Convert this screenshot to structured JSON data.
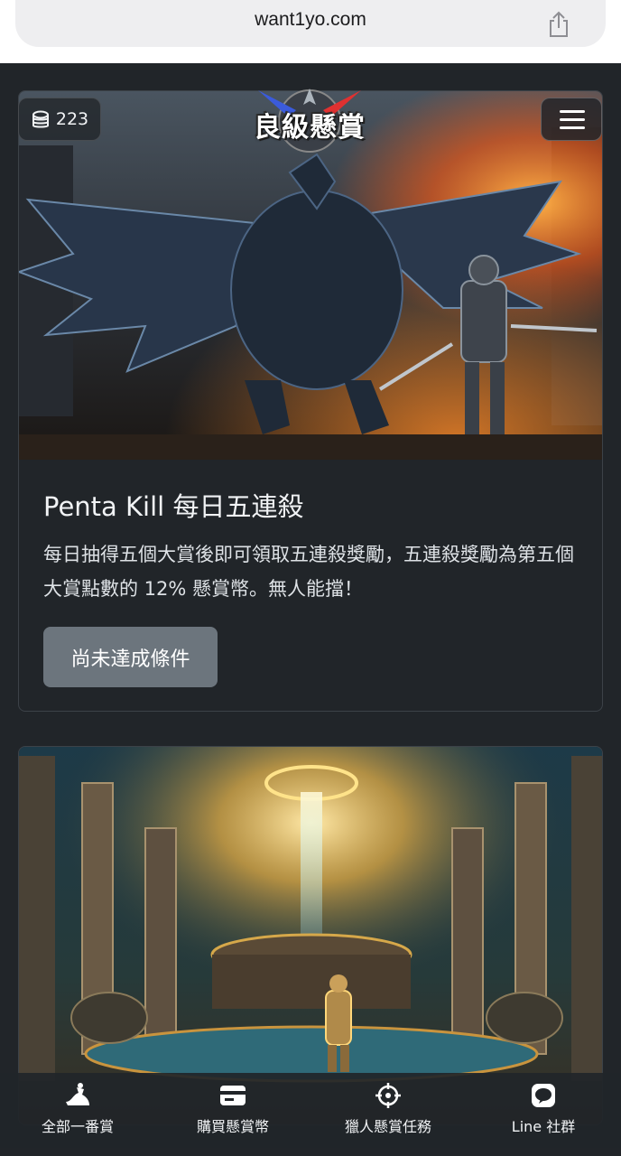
{
  "browser": {
    "url": "want1yo.com"
  },
  "header": {
    "coins": "223",
    "logo_text": "良級懸賞"
  },
  "cards": [
    {
      "title": "Penta Kill 每日五連殺",
      "description": "每日抽得五個大賞後即可領取五連殺獎勵，五連殺獎勵為第五個大賞點數的 12% 懸賞幣。無人能擋！",
      "button_label": "尚未達成條件",
      "image": "dragon-vs-knight-illustration"
    },
    {
      "image": "fantasy-fountain-hero-illustration"
    }
  ],
  "bottom_nav": [
    {
      "label": "全部一番賞",
      "icon": "ichiban-icon"
    },
    {
      "label": "購買懸賞幣",
      "icon": "card-icon"
    },
    {
      "label": "獵人懸賞任務",
      "icon": "crosshair-icon"
    },
    {
      "label": "Line 社群",
      "icon": "line-icon"
    }
  ],
  "colors": {
    "background": "#212529",
    "button_disabled": "#6c757d",
    "card_border": "#3c4248"
  }
}
